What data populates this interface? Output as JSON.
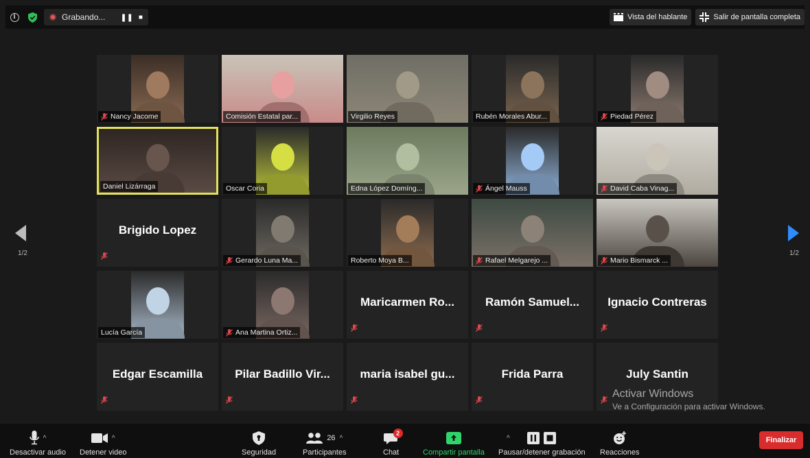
{
  "topbar": {
    "recording_label": "Grabando...",
    "speaker_view_label": "Vista del hablante",
    "exit_fullscreen_label": "Salir de pantalla completa"
  },
  "grid": {
    "page_indicator_left": "1/2",
    "page_indicator_right": "1/2",
    "tiles": [
      {
        "name": "Nancy Jacome",
        "muted": true,
        "video": true,
        "bg": "#3b2e26",
        "vid": "#8a6a52"
      },
      {
        "name": "Comisión Estatal par...",
        "muted": false,
        "video": true,
        "bg": "#c9c4b8",
        "vid": "#c98b8a"
      },
      {
        "name": "Virgilio Reyes",
        "muted": false,
        "video": true,
        "bg": "#6f6e66",
        "vid": "#8c8676"
      },
      {
        "name": "Rubén Morales Abur...",
        "muted": false,
        "video": true,
        "bg": "#2a2a2a",
        "vid": "#7a6550"
      },
      {
        "name": "Piedad Pérez",
        "muted": true,
        "video": true,
        "bg": "#2a2a2a",
        "vid": "#8b7a70"
      },
      {
        "name": "Daniel Lizárraga",
        "muted": false,
        "video": true,
        "bg": "#2e2622",
        "vid": "#5a4a44",
        "active": true
      },
      {
        "name": "Oscar Coria",
        "muted": false,
        "video": true,
        "bg": "#2a2a2a",
        "vid": "#b9c23a"
      },
      {
        "name": "Edna  López Domíng...",
        "muted": false,
        "video": true,
        "bg": "#6d7a5e",
        "vid": "#9aa58a"
      },
      {
        "name": "Ángel Mauss",
        "muted": true,
        "video": true,
        "bg": "#2a2a2a",
        "vid": "#8fb0d6"
      },
      {
        "name": "David Caba Vinag...",
        "muted": true,
        "video": true,
        "bg": "#d8d6d0",
        "vid": "#b0aba0"
      },
      {
        "name": "Brigido Lopez",
        "muted": true,
        "video": false
      },
      {
        "name": "Gerardo Luna Ma...",
        "muted": true,
        "video": true,
        "bg": "#2a2a2a",
        "vid": "#6f6a62"
      },
      {
        "name": "Roberto Moya B...",
        "muted": false,
        "video": true,
        "bg": "#2a2a2a",
        "vid": "#8e6c4e"
      },
      {
        "name": "Rafael Melgarejo ...",
        "muted": true,
        "video": true,
        "bg": "#3d4a42",
        "vid": "#7b7168"
      },
      {
        "name": "Mario Bismarck ...",
        "muted": true,
        "video": true,
        "bg": "#c9c6c0",
        "vid": "#4d4640"
      },
      {
        "name": "Lucía García",
        "muted": false,
        "video": true,
        "bg": "#2a2a2a",
        "vid": "#a8b8c8"
      },
      {
        "name": "Ana Martina Ortiz...",
        "muted": true,
        "video": true,
        "bg": "#2a2a2a",
        "vid": "#7a6862"
      },
      {
        "name": "Maricarmen  Ro...",
        "muted": true,
        "video": false
      },
      {
        "name": "Ramón Samuel...",
        "muted": true,
        "video": false
      },
      {
        "name": "Ignacio Contreras",
        "muted": true,
        "video": false
      },
      {
        "name": "Edgar Escamilla",
        "muted": true,
        "video": false
      },
      {
        "name": "Pilar Badillo Vir...",
        "muted": true,
        "video": false
      },
      {
        "name": "maria isabel gu...",
        "muted": true,
        "video": false
      },
      {
        "name": "Frida Parra",
        "muted": true,
        "video": false
      },
      {
        "name": "July Santin",
        "muted": true,
        "video": false
      }
    ]
  },
  "watermark": {
    "title": "Activar Windows",
    "subtitle": "Ve a Configuración para activar Windows."
  },
  "toolbar": {
    "mute_label": "Desactivar audio",
    "video_label": "Detener video",
    "security_label": "Seguridad",
    "participants_label": "Participantes",
    "participants_count": "26",
    "chat_label": "Chat",
    "chat_badge": "2",
    "share_label": "Compartir pantalla",
    "record_label": "Pausar/detener grabación",
    "reactions_label": "Reacciones",
    "end_label": "Finalizar"
  },
  "colors": {
    "active_speaker": "#e4e25a",
    "share_green": "#2fd56b",
    "end_red": "#d92d2d",
    "muted_red": "#e0474c"
  }
}
